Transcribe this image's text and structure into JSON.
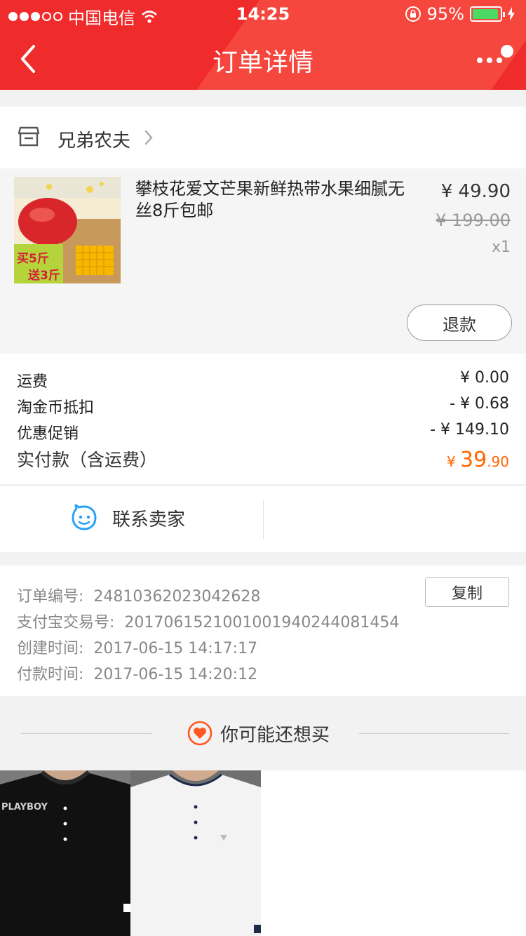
{
  "status": {
    "carrier": "中国电信",
    "time": "14:25",
    "battery": "95%",
    "battery_level": 0.95
  },
  "nav": {
    "title": "订单详情"
  },
  "shop": {
    "name": "兄弟农夫"
  },
  "item": {
    "name": "攀枝花爱文芒果新鲜热带水果细腻无丝8斤包邮",
    "price": "¥ 49.90",
    "original_price": "¥ 199.00",
    "quantity": "x1",
    "refund_label": "退款",
    "promo_top": "买5斤",
    "promo_bottom": "送3斤"
  },
  "fees": {
    "shipping_label": "运费",
    "shipping_value": "¥ 0.00",
    "coin_label": "淘金币抵扣",
    "coin_value": "- ¥ 0.68",
    "promo_label": "优惠促销",
    "promo_value": "- ¥ 149.10",
    "total_label": "实付款（含运费）",
    "total_currency": "¥ ",
    "total_int": "39",
    "total_dec": ".90"
  },
  "contact": {
    "label": "联系卖家"
  },
  "order": {
    "number_label": "订单编号:",
    "number": "24810362023042628",
    "alipay_label": "支付宝交易号:",
    "alipay": "2017061521001001940244081454",
    "created_label": "创建时间:",
    "created": "2017-06-15 14:17:17",
    "paid_label": "付款时间:",
    "paid": "2017-06-15 14:20:12",
    "copy_label": "复制"
  },
  "recommend": {
    "title": "你可能还想买",
    "brand_mark": "PLAYBOY"
  },
  "colors": {
    "header_red": "#f02b2b",
    "price_orange": "#ff6600",
    "accent_blue": "#29a1f7"
  }
}
